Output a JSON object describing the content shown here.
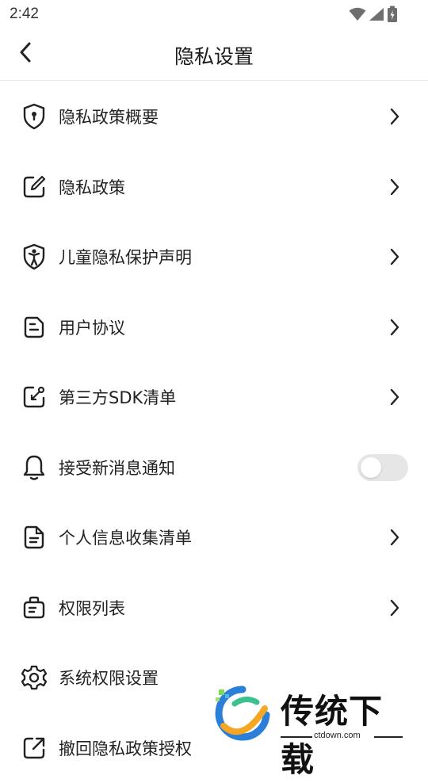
{
  "status_bar": {
    "time": "2:42"
  },
  "header": {
    "title": "隐私设置"
  },
  "menu": {
    "items": [
      {
        "label": "隐私政策概要",
        "icon": "shield-lock-icon",
        "control": "chevron"
      },
      {
        "label": "隐私政策",
        "icon": "pen-document-icon",
        "control": "chevron"
      },
      {
        "label": "儿童隐私保护声明",
        "icon": "child-shield-icon",
        "control": "chevron"
      },
      {
        "label": "用户协议",
        "icon": "agreement-document-icon",
        "control": "chevron"
      },
      {
        "label": "第三方SDK清单",
        "icon": "external-link-square-icon",
        "control": "chevron"
      },
      {
        "label": "接受新消息通知",
        "icon": "bell-icon",
        "control": "toggle",
        "toggle_on": false
      },
      {
        "label": "个人信息收集清单",
        "icon": "document-list-icon",
        "control": "chevron"
      },
      {
        "label": "权限列表",
        "icon": "briefcase-list-icon",
        "control": "chevron"
      },
      {
        "label": "系统权限设置",
        "icon": "gear-icon",
        "control": "none"
      },
      {
        "label": "撤回隐私政策授权",
        "icon": "share-out-icon",
        "control": "none"
      }
    ]
  },
  "watermark": {
    "title": "传统下载",
    "url": "ctdown.com"
  },
  "colors": {
    "text": "#222222",
    "divider": "#ececec",
    "toggle_off": "#e6e6e6"
  }
}
